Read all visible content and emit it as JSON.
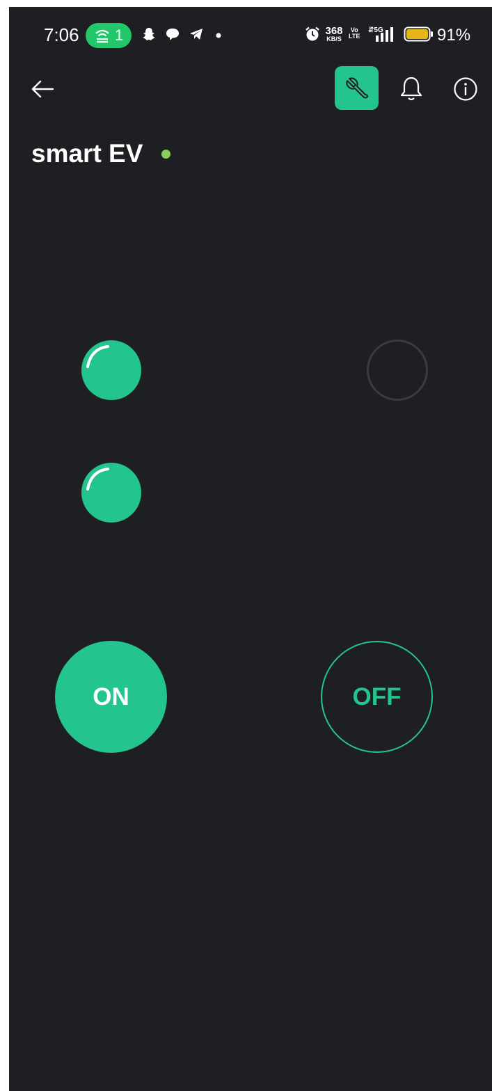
{
  "status_bar": {
    "time": "7:06",
    "hotspot_count": "1",
    "net_speed_value": "368",
    "net_speed_unit": "KB/S",
    "volte_top": "Vo",
    "volte_bottom": "LTE",
    "battery_percent": "91%"
  },
  "header": {
    "back_icon": "arrow-left-icon",
    "tool_icon": "wrench-icon",
    "bell_icon": "bell-icon",
    "info_icon": "info-icon"
  },
  "device": {
    "name": "smart EV",
    "status": "online"
  },
  "leds": [
    {
      "state": "on"
    },
    {
      "state": "off"
    },
    {
      "state": "on"
    }
  ],
  "buttons": {
    "on_label": "ON",
    "off_label": "OFF"
  },
  "colors": {
    "accent": "#23c48e",
    "background": "#1e1f22",
    "online": "#8bd05a",
    "hotspot": "#21c768",
    "battery": "#e4b418"
  }
}
